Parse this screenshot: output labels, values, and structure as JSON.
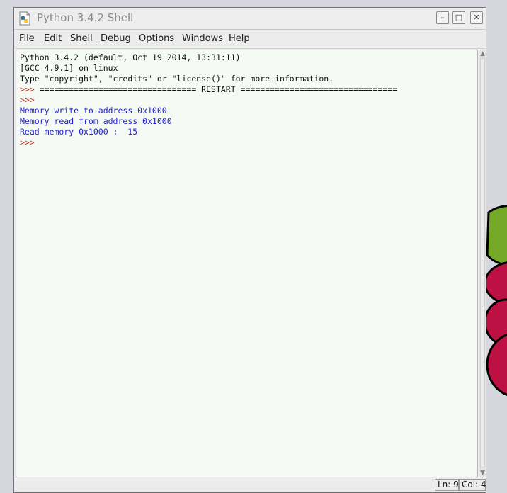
{
  "window": {
    "title": "Python 3.4.2 Shell",
    "icon": "python-file-icon",
    "controls": {
      "minimize": "minimize-icon",
      "maximize": "maximize-icon",
      "close": "close-icon"
    }
  },
  "menubar": {
    "items": [
      {
        "label": "File",
        "mnemonic": "F"
      },
      {
        "label": "Edit",
        "mnemonic": "E"
      },
      {
        "label": "Shell",
        "mnemonic": "l"
      },
      {
        "label": "Debug",
        "mnemonic": "D"
      },
      {
        "label": "Options",
        "mnemonic": "O"
      },
      {
        "label": "Windows",
        "mnemonic": "W"
      },
      {
        "label": "Help",
        "mnemonic": "H"
      }
    ]
  },
  "shell": {
    "lines": [
      {
        "text": "Python 3.4.2 (default, Oct 19 2014, 13:31:11)",
        "kind": "std"
      },
      {
        "text": "[GCC 4.9.1] on linux",
        "kind": "std"
      },
      {
        "text": "Type \"copyright\", \"credits\" or \"license()\" for more information.",
        "kind": "std"
      },
      {
        "prompt": ">>> ",
        "text": "================================ RESTART ================================",
        "kind": "restart"
      },
      {
        "prompt": ">>> ",
        "text": "",
        "kind": "prompt"
      },
      {
        "text": "Memory write to address 0x1000",
        "kind": "out"
      },
      {
        "text": "Memory read from address 0x1000",
        "kind": "out"
      },
      {
        "text": "Read memory 0x1000 :  15",
        "kind": "out"
      },
      {
        "prompt": ">>> ",
        "text": "",
        "kind": "prompt"
      }
    ]
  },
  "statusbar": {
    "line": "Ln: 9",
    "col": "Col: 4"
  },
  "colors": {
    "prompt": "#c0392b",
    "stdout": "#2222cc",
    "text": "#111111",
    "editor_bg": "#f5faf5"
  }
}
